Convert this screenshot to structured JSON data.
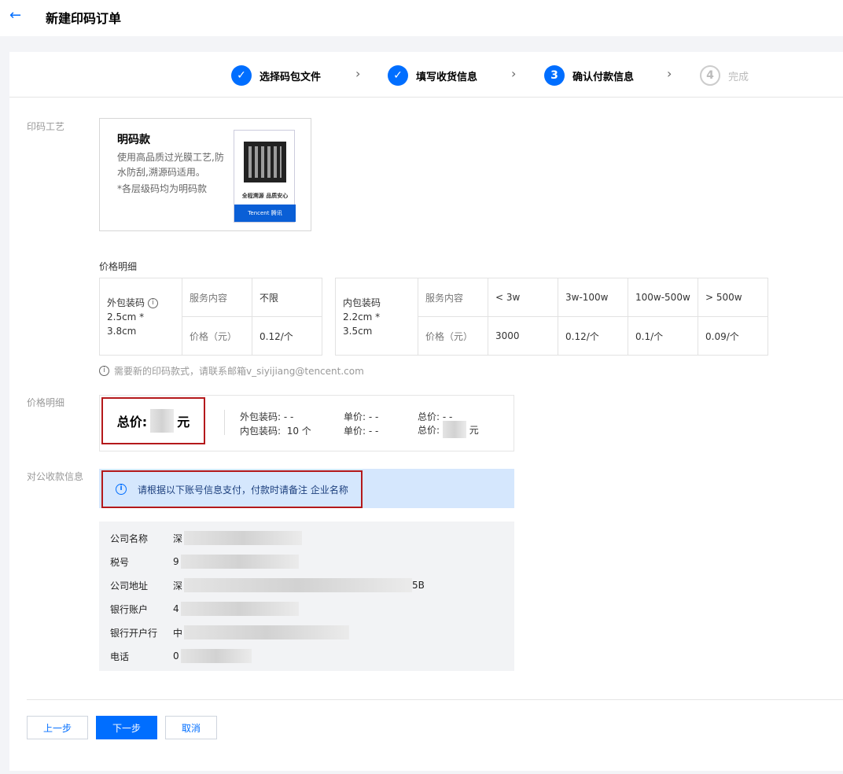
{
  "header": {
    "back_icon": "arrow-left-icon",
    "title": "新建印码订单"
  },
  "steps": [
    {
      "label": "选择码包文件",
      "state": "done"
    },
    {
      "label": "填写收货信息",
      "state": "done"
    },
    {
      "num": "3",
      "label": "确认付款信息",
      "state": "active"
    },
    {
      "num": "4",
      "label": "完成",
      "state": "pending"
    }
  ],
  "craft": {
    "field_label": "印码工艺",
    "name": "明码款",
    "desc": "使用高品质过光膜工艺,防水防刮,溯源码适用。",
    "note": "*各层级码均为明码款",
    "qr_slogan": "全程溯源 品质安心",
    "qr_brand": "Tencent 腾讯"
  },
  "price_detail": {
    "title": "价格明细",
    "outer": {
      "name": "外包装码",
      "size": "2.5cm * 3.8cm",
      "row1_label": "服务内容",
      "row1_value": "不限",
      "row2_label": "价格（元）",
      "row2_value": "0.12/个"
    },
    "inner": {
      "name": "内包装码",
      "size": "2.2cm * 3.5cm",
      "row1_label": "服务内容",
      "row2_label": "价格（元）",
      "tiers": [
        "< 3w",
        "3w-100w",
        "100w-500w",
        "> 500w"
      ],
      "prices": [
        "3000",
        "0.12/个",
        "0.1/个",
        "0.09/个"
      ]
    },
    "contact": "需要新的印码款式，请联系邮箱v_siyijiang@tencent.com"
  },
  "summary": {
    "field_label": "价格明细",
    "total_label": "总价:",
    "total_unit": "元",
    "outer_label": "外包装码:",
    "outer_qty": "- -",
    "inner_label": "内包装码:",
    "inner_qty": "10 个",
    "unit_price_label": "单价:",
    "outer_unit": "- -",
    "inner_unit": "- -",
    "subtotal_label": "总价:",
    "outer_subtotal": "- -",
    "inner_subtotal_unit": "元"
  },
  "payment": {
    "field_label": "对公收款信息",
    "notice": "请根据以下账号信息支付，付款时请备注 企业名称",
    "rows": [
      {
        "key": "公司名称",
        "value": "深"
      },
      {
        "key": "税号",
        "value": "9"
      },
      {
        "key": "公司地址",
        "value": "深",
        "suffix": "5B"
      },
      {
        "key": "银行账户",
        "value": "4"
      },
      {
        "key": "银行开户行",
        "value": "中"
      },
      {
        "key": "电话",
        "value": "0"
      }
    ]
  },
  "actions": {
    "prev": "上一步",
    "next": "下一步",
    "cancel": "取消"
  }
}
